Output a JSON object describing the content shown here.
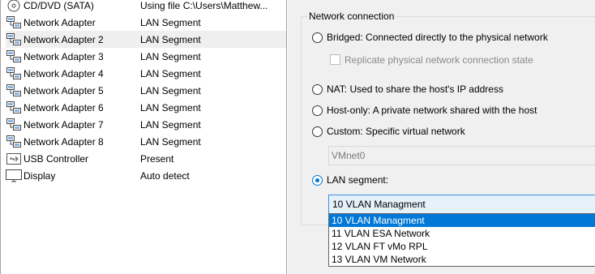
{
  "devices": [
    {
      "name": "CD/DVD (SATA)",
      "summary": "Using file C:\\Users\\Matthew...",
      "icon": "cd-drive-icon"
    },
    {
      "name": "Network Adapter",
      "summary": "LAN Segment",
      "icon": "network-adapter-icon"
    },
    {
      "name": "Network Adapter 2",
      "summary": "LAN Segment",
      "icon": "network-adapter-icon",
      "selected": true
    },
    {
      "name": "Network Adapter 3",
      "summary": "LAN Segment",
      "icon": "network-adapter-icon"
    },
    {
      "name": "Network Adapter 4",
      "summary": "LAN Segment",
      "icon": "network-adapter-icon"
    },
    {
      "name": "Network Adapter 5",
      "summary": "LAN Segment",
      "icon": "network-adapter-icon"
    },
    {
      "name": "Network Adapter 6",
      "summary": "LAN Segment",
      "icon": "network-adapter-icon"
    },
    {
      "name": "Network Adapter 7",
      "summary": "LAN Segment",
      "icon": "network-adapter-icon"
    },
    {
      "name": "Network Adapter 8",
      "summary": "LAN Segment",
      "icon": "network-adapter-icon"
    },
    {
      "name": "USB Controller",
      "summary": "Present",
      "icon": "usb-controller-icon"
    },
    {
      "name": "Display",
      "summary": "Auto detect",
      "icon": "display-icon"
    }
  ],
  "network_connection": {
    "title": "Network connection",
    "bridged": "Bridged: Connected directly to the physical network",
    "replicate": "Replicate physical network connection state",
    "nat": "NAT: Used to share the host's IP address",
    "host_only": "Host-only: A private network shared with the host",
    "custom": "Custom: Specific virtual network",
    "custom_value": "VMnet0",
    "lan_segment": "LAN segment:",
    "lan_selected": "10 VLAN Managment",
    "lan_options": [
      "10 VLAN Managment",
      "11 VLAN ESA Network",
      "12 VLAN FT vMo RPL",
      "13 VLAN VM Network"
    ],
    "selected_option": "lan_segment"
  },
  "colors": {
    "selection": "#0078d7",
    "list_highlight": "#efefef",
    "panel_bg": "#f0f0f0"
  }
}
